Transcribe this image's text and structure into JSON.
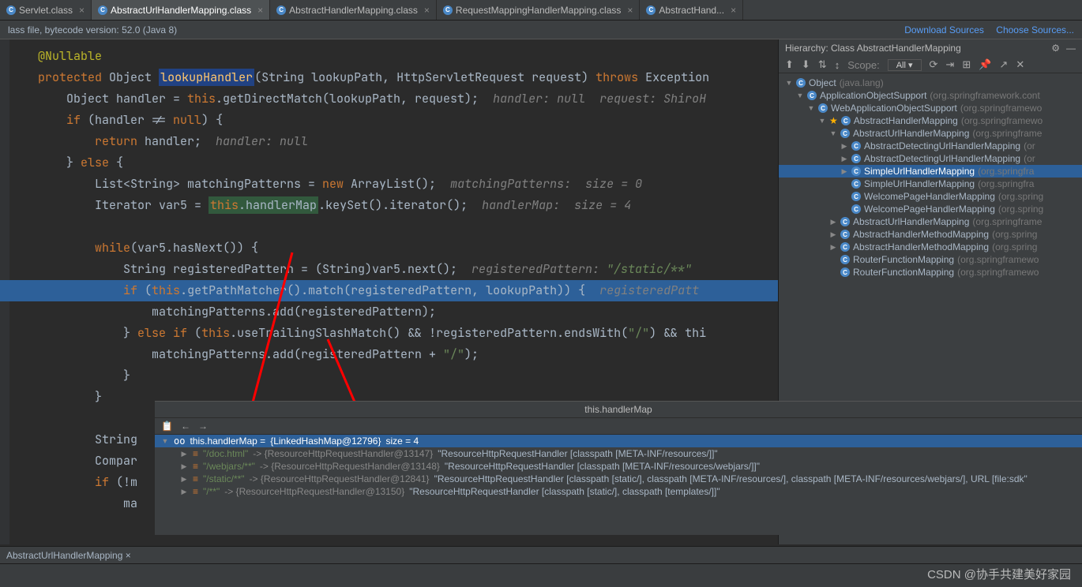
{
  "tabs": [
    {
      "label": "Servlet.class"
    },
    {
      "label": "AbstractUrlHandlerMapping.class",
      "active": true
    },
    {
      "label": "AbstractHandlerMapping.class"
    },
    {
      "label": "RequestMappingHandlerMapping.class"
    },
    {
      "label": "AbstractHand..."
    }
  ],
  "statusLeft": "lass file, bytecode version: 52.0 (Java 8)",
  "linkDownload": "Download Sources",
  "linkChoose": "Choose Sources...",
  "code": {
    "ann": "@Nullable",
    "sig_protected": "protected",
    "sig_type": "Object",
    "sig_name": "lookupHandler",
    "sig_rest": "(String lookupPath, HttpServletRequest request) ",
    "sig_throws": "throws",
    "sig_ex": " Exception",
    "l1a": "Object handler = ",
    "l1b": ".getDirectMatch(lookupPath, request);  ",
    "l1c": "handler: null  request: ShiroH",
    "l2a": " (handler != ",
    "l2b": ") {",
    "l3a": " handler;  ",
    "l3b": "handler: null",
    "l4": "} ",
    "l4b": " {",
    "l5a": "List<String> matchingPatterns = ",
    "l5b": " ArrayList();  ",
    "l5c": "matchingPatterns:  size = 0",
    "l6a": "Iterator var5 = ",
    "l6b": ".handlerMap",
    "l6c": ".keySet().iterator();  ",
    "l6d": "handlerMap:  size = 4",
    "l7": "(var5.hasNext()) {",
    "l8a": "String registeredPattern = (String)var5.next();  ",
    "l8b": "registeredPattern: ",
    "l8c": "\"/static/**\"",
    "l9a": " (",
    "l9b": ".getPathMatcher().match(registeredPattern, lookupPath)) {  ",
    "l9c": "registeredPatt",
    "l10": "matchingPatterns.add(registeredPattern);",
    "l11a": "} ",
    "l11b": " (",
    "l11c": ".useTrailingSlashMatch() && !registeredPattern.endsWith(",
    "l11d": "\"/\"",
    "l11e": ") && thi",
    "l12a": "matchingPatterns.add(registeredPattern + ",
    "l12b": "\"/\"",
    "l12c": ");",
    "l13": "}",
    "l14": "}",
    "l15": "String",
    "l16": "Compar",
    "l17": " (!m",
    "l18": "ma",
    "this": "this",
    "kw_if": "if",
    "kw_null": "null",
    "kw_return": "return",
    "kw_else": "else",
    "kw_new": "new",
    "kw_while": "while",
    "kw_elseif": "else if"
  },
  "hierarchy": {
    "title": "Hierarchy:  Class AbstractHandlerMapping",
    "scope": "Scope:",
    "scopeVal": "All",
    "items": [
      {
        "indent": 0,
        "chev": "▼",
        "label": "Object",
        "pkg": "(java.lang)",
        "sel": false
      },
      {
        "indent": 1,
        "chev": "▼",
        "label": "ApplicationObjectSupport",
        "pkg": "(org.springframework.cont",
        "sel": false
      },
      {
        "indent": 2,
        "chev": "▼",
        "label": "WebApplicationObjectSupport",
        "pkg": "(org.springframewo",
        "sel": false
      },
      {
        "indent": 3,
        "chev": "▼",
        "label": "AbstractHandlerMapping",
        "pkg": "(org.springframewo",
        "sel": false,
        "star": true
      },
      {
        "indent": 4,
        "chev": "▼",
        "label": "AbstractUrlHandlerMapping",
        "pkg": "(org.springframe",
        "sel": false
      },
      {
        "indent": 5,
        "chev": "▶",
        "label": "AbstractDetectingUrlHandlerMapping",
        "pkg": "(or",
        "sel": false
      },
      {
        "indent": 5,
        "chev": "▶",
        "label": "AbstractDetectingUrlHandlerMapping",
        "pkg": "(or",
        "sel": false
      },
      {
        "indent": 5,
        "chev": "▶",
        "label": "SimpleUrlHandlerMapping",
        "pkg": "(org.springfra",
        "sel": true
      },
      {
        "indent": 5,
        "chev": "",
        "label": "SimpleUrlHandlerMapping",
        "pkg": "(org.springfra",
        "sel": false
      },
      {
        "indent": 5,
        "chev": "",
        "label": "WelcomePageHandlerMapping",
        "pkg": "(org.spring",
        "sel": false
      },
      {
        "indent": 5,
        "chev": "",
        "label": "WelcomePageHandlerMapping",
        "pkg": "(org.spring",
        "sel": false
      },
      {
        "indent": 4,
        "chev": "▶",
        "label": "AbstractUrlHandlerMapping",
        "pkg": "(org.springframe",
        "sel": false
      },
      {
        "indent": 4,
        "chev": "▶",
        "label": "AbstractHandlerMethodMapping",
        "pkg": "(org.spring",
        "sel": false
      },
      {
        "indent": 4,
        "chev": "▶",
        "label": "AbstractHandlerMethodMapping",
        "pkg": "(org.spring",
        "sel": false
      },
      {
        "indent": 4,
        "chev": "",
        "label": "RouterFunctionMapping",
        "pkg": "(org.springframewo",
        "sel": false
      },
      {
        "indent": 4,
        "chev": "",
        "label": "RouterFunctionMapping",
        "pkg": "(org.springframewo",
        "sel": false
      }
    ]
  },
  "debug": {
    "title": "this.handlerMap",
    "root": "this.handlerMap = ",
    "rootType": "{LinkedHashMap@12796}",
    "rootSize": "  size = 4",
    "entries": [
      {
        "key": "\"/doc.html\"",
        "ref": "{ResourceHttpRequestHandler@13147}",
        "val": "\"ResourceHttpRequestHandler [classpath [META-INF/resources/]]\""
      },
      {
        "key": "\"/webjars/**\"",
        "ref": "{ResourceHttpRequestHandler@13148}",
        "val": "\"ResourceHttpRequestHandler [classpath [META-INF/resources/webjars/]]\""
      },
      {
        "key": "\"/static/**\"",
        "ref": "{ResourceHttpRequestHandler@12841}",
        "val": "\"ResourceHttpRequestHandler [classpath [static/], classpath [META-INF/resources/], classpath [META-INF/resources/webjars/], URL [file:sdk\""
      },
      {
        "key": "\"/**\"",
        "ref": "{ResourceHttpRequestHandler@13150}",
        "val": "\"ResourceHttpRequestHandler [classpath [static/], classpath [templates/]]\""
      }
    ]
  },
  "bottomTab": "AbstractUrlHandlerMapping",
  "watermark": "CSDN @协手共建美好家园"
}
